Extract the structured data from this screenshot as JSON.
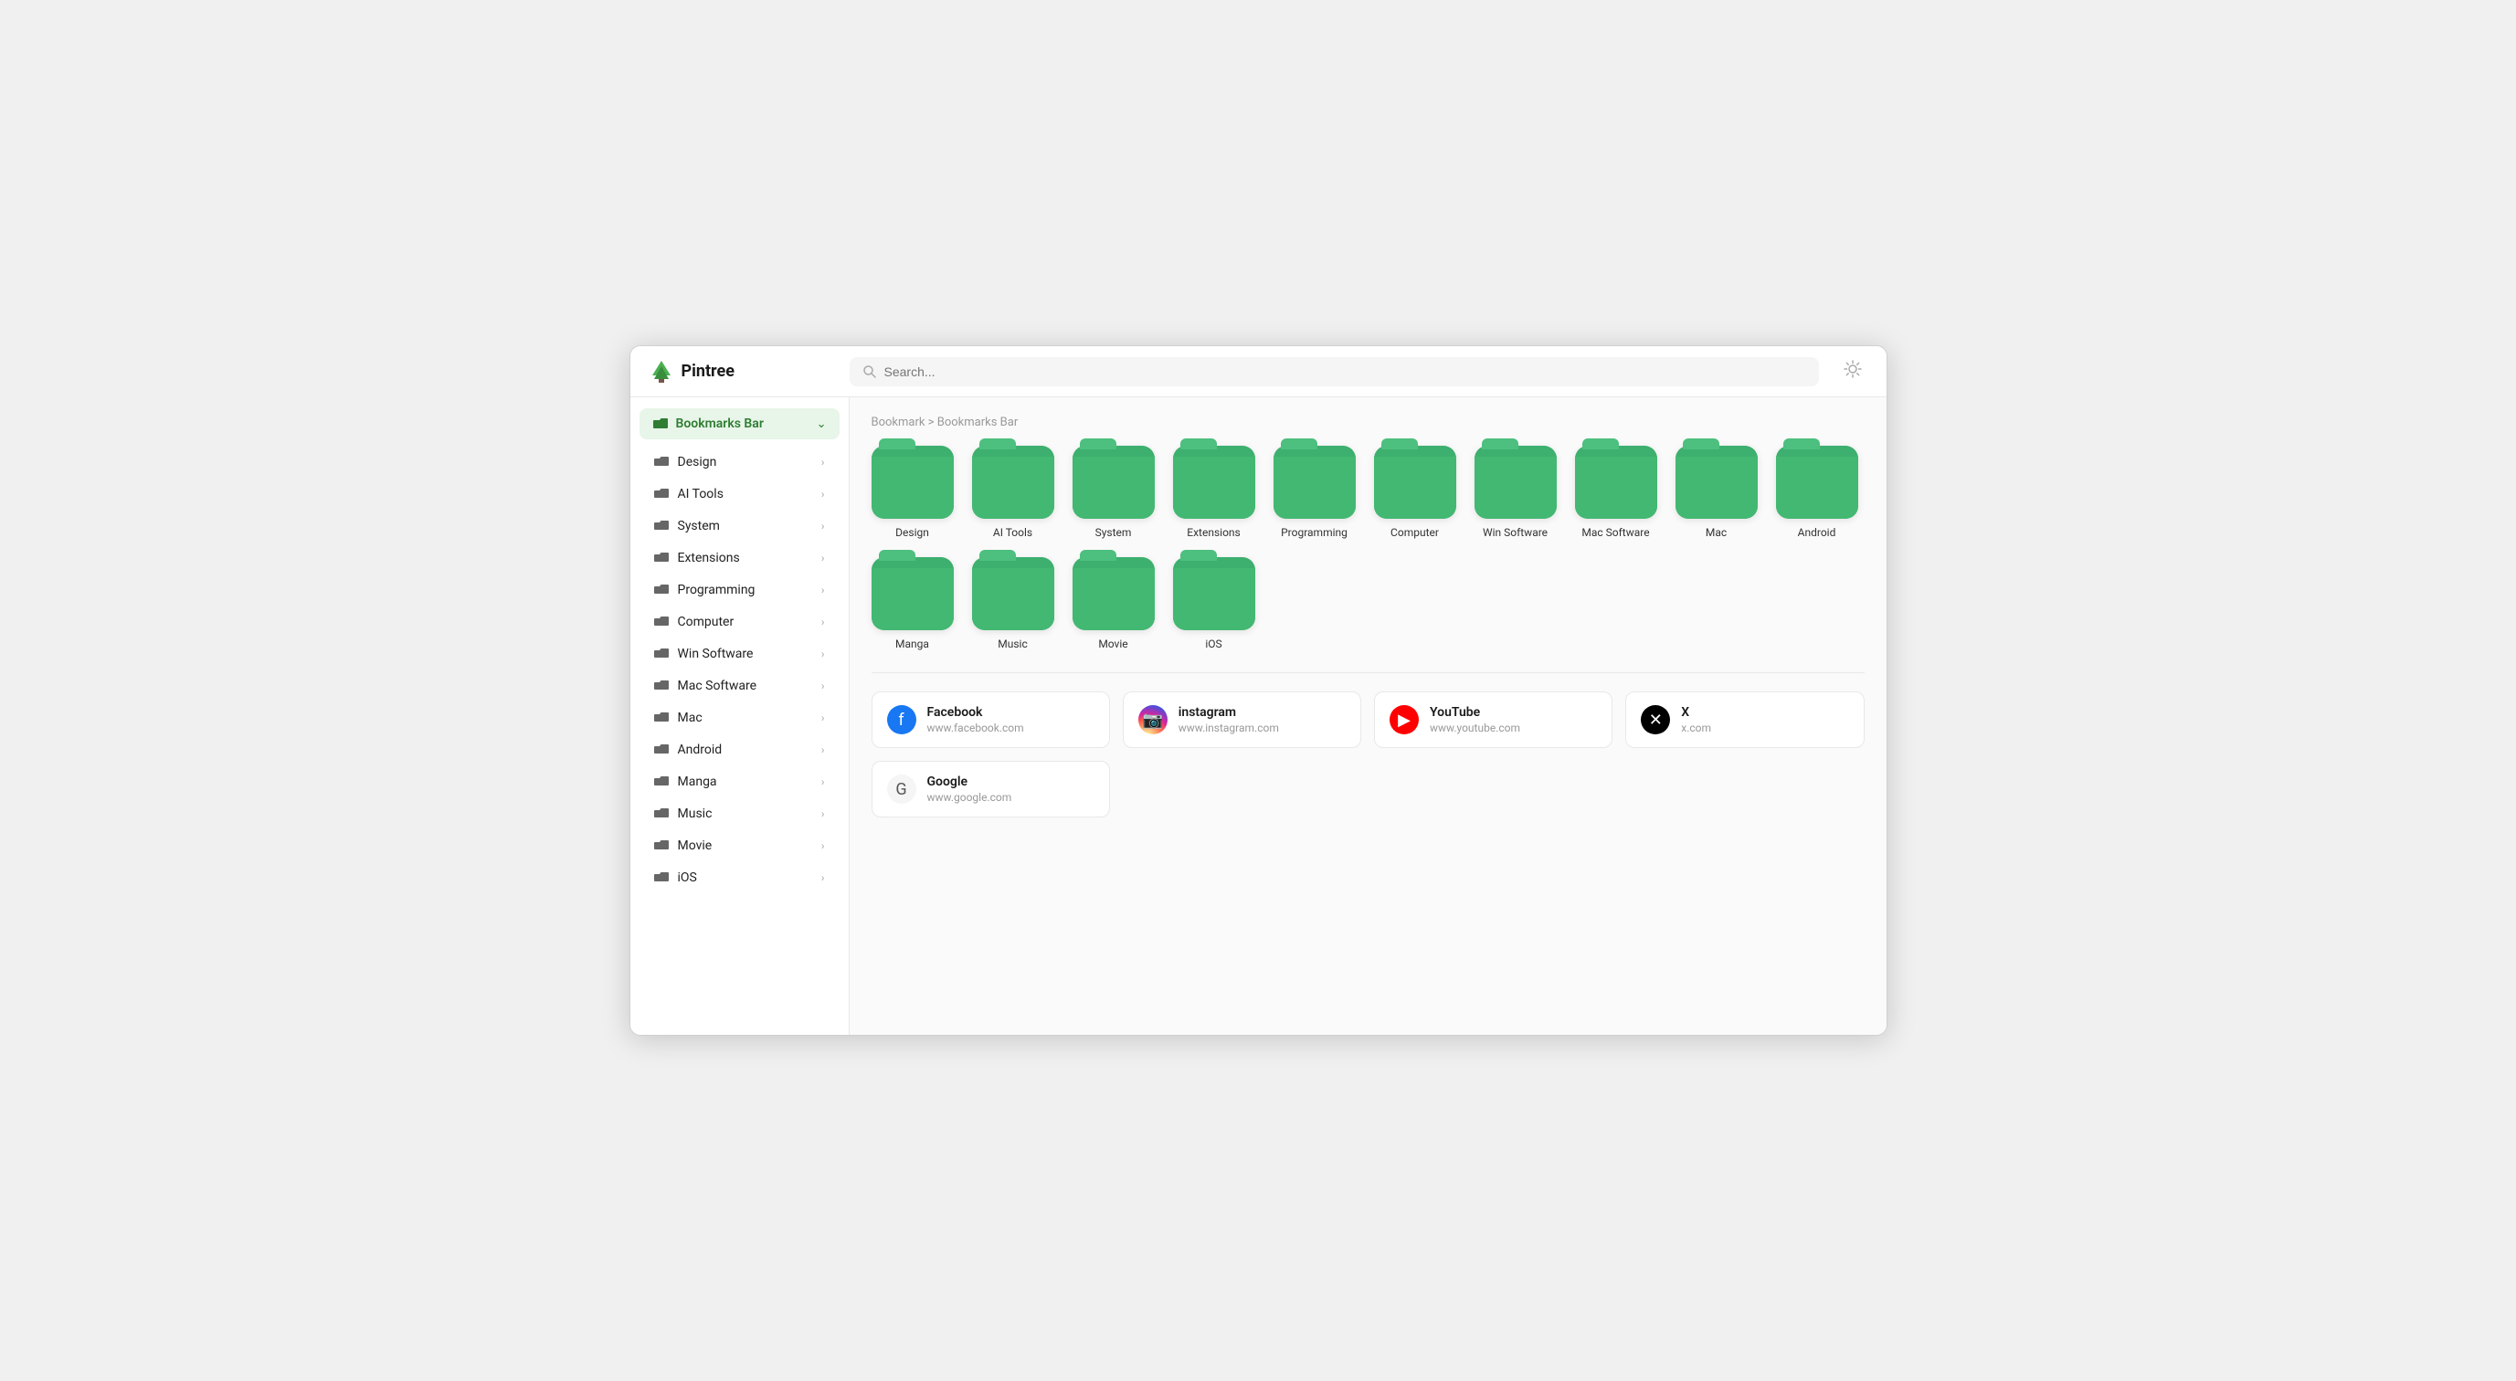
{
  "app": {
    "name": "Pintree"
  },
  "header": {
    "search_placeholder": "Search...",
    "theme_icon": "☀"
  },
  "sidebar": {
    "bookmarks_bar_label": "Bookmarks Bar",
    "items": [
      {
        "id": "design",
        "label": "Design"
      },
      {
        "id": "ai-tools",
        "label": "AI Tools"
      },
      {
        "id": "system",
        "label": "System"
      },
      {
        "id": "extensions",
        "label": "Extensions"
      },
      {
        "id": "programming",
        "label": "Programming"
      },
      {
        "id": "computer",
        "label": "Computer"
      },
      {
        "id": "win-software",
        "label": "Win Software"
      },
      {
        "id": "mac-software",
        "label": "Mac Software"
      },
      {
        "id": "mac",
        "label": "Mac"
      },
      {
        "id": "android",
        "label": "Android"
      },
      {
        "id": "manga",
        "label": "Manga"
      },
      {
        "id": "music",
        "label": "Music"
      },
      {
        "id": "movie",
        "label": "Movie"
      },
      {
        "id": "ios",
        "label": "iOS"
      }
    ]
  },
  "breadcrumb": "Bookmark > Bookmarks Bar",
  "folders": [
    {
      "id": "design",
      "name": "Design"
    },
    {
      "id": "ai-tools",
      "name": "AI Tools"
    },
    {
      "id": "system",
      "name": "System"
    },
    {
      "id": "extensions",
      "name": "Extensions"
    },
    {
      "id": "programming",
      "name": "Programming"
    },
    {
      "id": "computer",
      "name": "Computer"
    },
    {
      "id": "win-software",
      "name": "Win Software"
    },
    {
      "id": "mac-software",
      "name": "Mac Software"
    },
    {
      "id": "mac",
      "name": "Mac"
    },
    {
      "id": "android",
      "name": "Android"
    },
    {
      "id": "manga",
      "name": "Manga"
    },
    {
      "id": "music",
      "name": "Music"
    },
    {
      "id": "movie",
      "name": "Movie"
    },
    {
      "id": "ios",
      "name": "iOS"
    }
  ],
  "bookmarks": [
    {
      "id": "facebook",
      "title": "Facebook",
      "url": "www.facebook.com",
      "favicon_type": "facebook",
      "favicon_char": "f"
    },
    {
      "id": "instagram",
      "title": "instagram",
      "url": "www.instagram.com",
      "favicon_type": "instagram",
      "favicon_char": "📷"
    },
    {
      "id": "youtube",
      "title": "YouTube",
      "url": "www.youtube.com",
      "favicon_type": "youtube",
      "favicon_char": "▶"
    },
    {
      "id": "x",
      "title": "X",
      "url": "x.com",
      "favicon_type": "x",
      "favicon_char": "✕"
    },
    {
      "id": "google",
      "title": "Google",
      "url": "www.google.com",
      "favicon_type": "google",
      "favicon_char": "G"
    }
  ]
}
